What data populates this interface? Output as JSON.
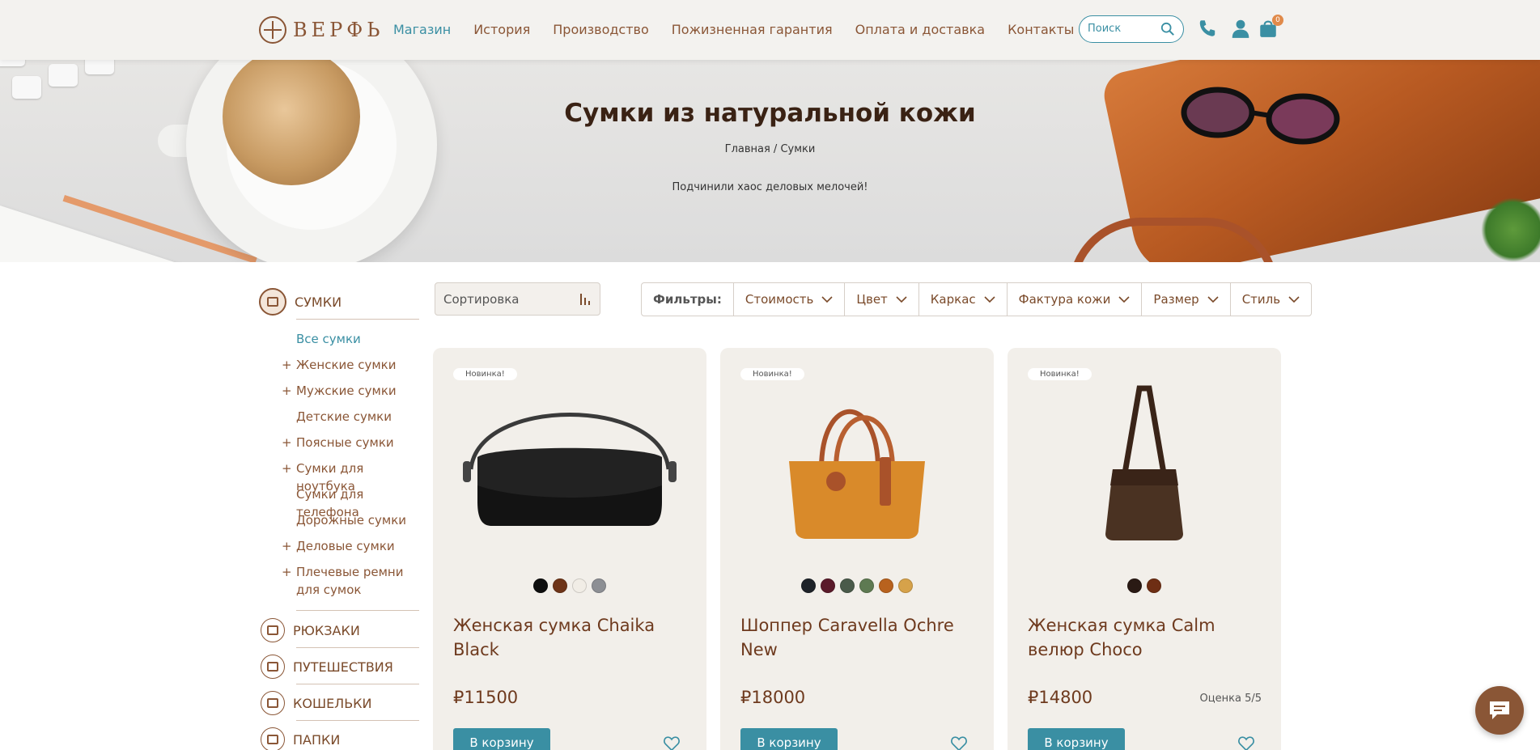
{
  "header": {
    "logo_text": "ВЕРФЬ",
    "nav": [
      {
        "label": "Магазин"
      },
      {
        "label": "История"
      },
      {
        "label": "Производство"
      },
      {
        "label": "Пожизненная гарантия"
      },
      {
        "label": "Оплата и доставка"
      },
      {
        "label": "Контакты"
      }
    ],
    "search_placeholder": "Поиск",
    "cart_count": "0",
    "icons": [
      "search-icon",
      "phone-icon",
      "account-icon",
      "cart-icon"
    ]
  },
  "hero": {
    "title": "Сумки из натуральной кожи",
    "breadcrumb": {
      "home": "Главная",
      "sep": " / ",
      "current": "Сумки"
    },
    "tagline": "Подчинили хаос деловых мелочей!"
  },
  "sidebar": {
    "categories": [
      {
        "label": "СУМКИ",
        "icon": "bag-icon"
      },
      {
        "label": "РЮКЗАКИ",
        "icon": "backpack-icon"
      },
      {
        "label": "ПУТЕШЕСТВИЯ",
        "icon": "luggage-icon"
      },
      {
        "label": "КОШЕЛЬКИ",
        "icon": "wallet-icon"
      },
      {
        "label": "ПАПКИ",
        "icon": "folder-icon"
      }
    ],
    "sub_items": [
      {
        "label": "Все сумки",
        "plus": ""
      },
      {
        "label": "Женские сумки",
        "plus": "+"
      },
      {
        "label": "Мужские сумки",
        "plus": "+"
      },
      {
        "label": "Детские сумки",
        "plus": ""
      },
      {
        "label": "Поясные сумки",
        "plus": "+"
      },
      {
        "label": "Сумки для ноутбука",
        "plus": "+"
      },
      {
        "label": "Сумки для телефона",
        "plus": ""
      },
      {
        "label": "Дорожные сумки",
        "plus": ""
      },
      {
        "label": "Деловые сумки",
        "plus": "+"
      },
      {
        "label": "Плечевые ремни для сумок",
        "plus": "+"
      }
    ]
  },
  "toolbar": {
    "sort_label": "Сортировка",
    "filters_label": "Фильтры:",
    "filters": [
      "Стоимость",
      "Цвет",
      "Каркас",
      "Фактура кожи",
      "Размер",
      "Стиль"
    ]
  },
  "products": [
    {
      "badge": "Новинка!",
      "name": "Женская сумка Chaika Black",
      "price": "₽11500",
      "rating": "",
      "cart_label": "В корзину",
      "swatches": [
        "#0e0e0e",
        "#6e3418",
        "#f1ede6",
        "#8d8f94"
      ]
    },
    {
      "badge": "Новинка!",
      "name": "Шоппер Caravella Ochre New",
      "price": "₽18000",
      "rating": "",
      "cart_label": "В корзину",
      "swatches": [
        "#1e2329",
        "#5a1a2a",
        "#4a5a4a",
        "#5e7a52",
        "#b8621e",
        "#d6a24a"
      ]
    },
    {
      "badge": "Новинка!",
      "name": "Женская сумка Calm велюр Choco",
      "price": "₽14800",
      "rating": "Оценка 5/5",
      "cart_label": "В корзину",
      "swatches": [
        "#2a1a14",
        "#6e2e14"
      ]
    }
  ],
  "colors": {
    "accent": "#3a8fa3",
    "brand_brown": "#8a5636",
    "card_bg": "#f2efea"
  }
}
